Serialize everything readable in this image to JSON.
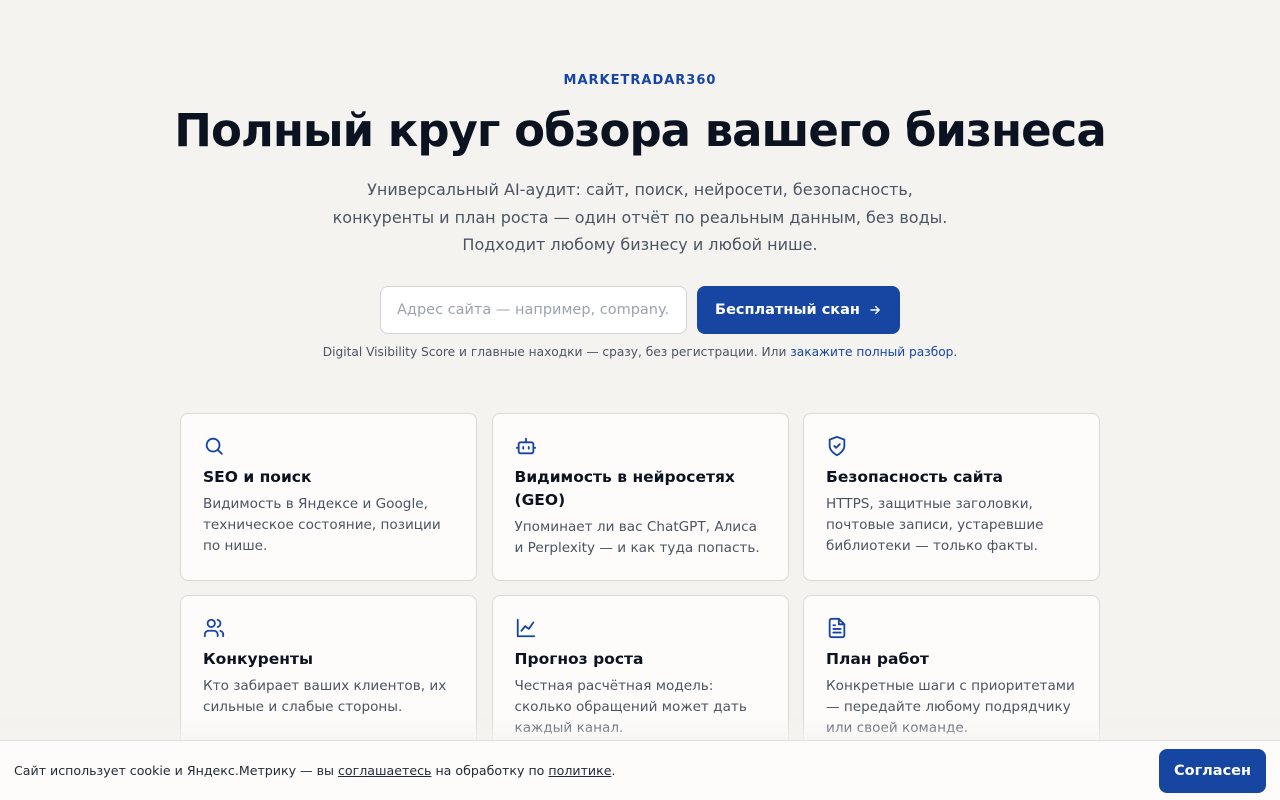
{
  "brand": "MARKETRADAR360",
  "hero": {
    "title": "Полный круг обзора вашего бизнеса",
    "subtitle_lines": [
      "Универсальный AI-аудит: сайт, поиск, нейросети, безопасность,",
      "конкуренты и план роста — один отчёт по реальным данным, без воды.",
      "Подходит любому бизнесу и любой нише."
    ]
  },
  "search": {
    "placeholder": "Адрес сайта — например, company.ru",
    "value": "",
    "button_label": "Бесплатный скан",
    "button_icon": "arrow-right-icon"
  },
  "note": {
    "text": "Digital Visibility Score и главные находки — сразу, без регистрации. Или ",
    "link": "закажите полный разбор",
    "suffix": "."
  },
  "cards": [
    {
      "icon": "search-icon",
      "title": "SEO и поиск",
      "desc": "Видимость в Яндексе и Google, техническое состояние, позиции по нише."
    },
    {
      "icon": "bot-icon",
      "title": "Видимость в нейросетях (GEO)",
      "desc": "Упоминает ли вас ChatGPT, Алиса и Perplexity — и как туда попасть."
    },
    {
      "icon": "shield-check-icon",
      "title": "Безопасность сайта",
      "desc": "HTTPS, защитные заголовки, почтовые записи, устаревшие библиотеки — только факты."
    },
    {
      "icon": "users-icon",
      "title": "Конкуренты",
      "desc": "Кто забирает ваших клиентов, их сильные и слабые стороны."
    },
    {
      "icon": "chart-line-icon",
      "title": "Прогноз роста",
      "desc": "Честная расчётная модель: сколько обращений может дать каждый канал."
    },
    {
      "icon": "file-text-icon",
      "title": "План работ",
      "desc": "Конкретные шаги с приоритетами — передайте любому подрядчику или своей команде."
    }
  ],
  "cookie": {
    "text_start": "Сайт использует cookie и Яндекс.Метрику — вы ",
    "link_agree": "соглашаетесь",
    "text_mid": " на обработку по ",
    "link_policy": "политике",
    "text_end": ".",
    "button_label": "Согласен"
  },
  "colors": {
    "accent": "#1746a2",
    "background": "#f4f3f0",
    "card_background": "#fdfcfb",
    "heading": "#0b1220",
    "body_text": "#4b5563"
  }
}
